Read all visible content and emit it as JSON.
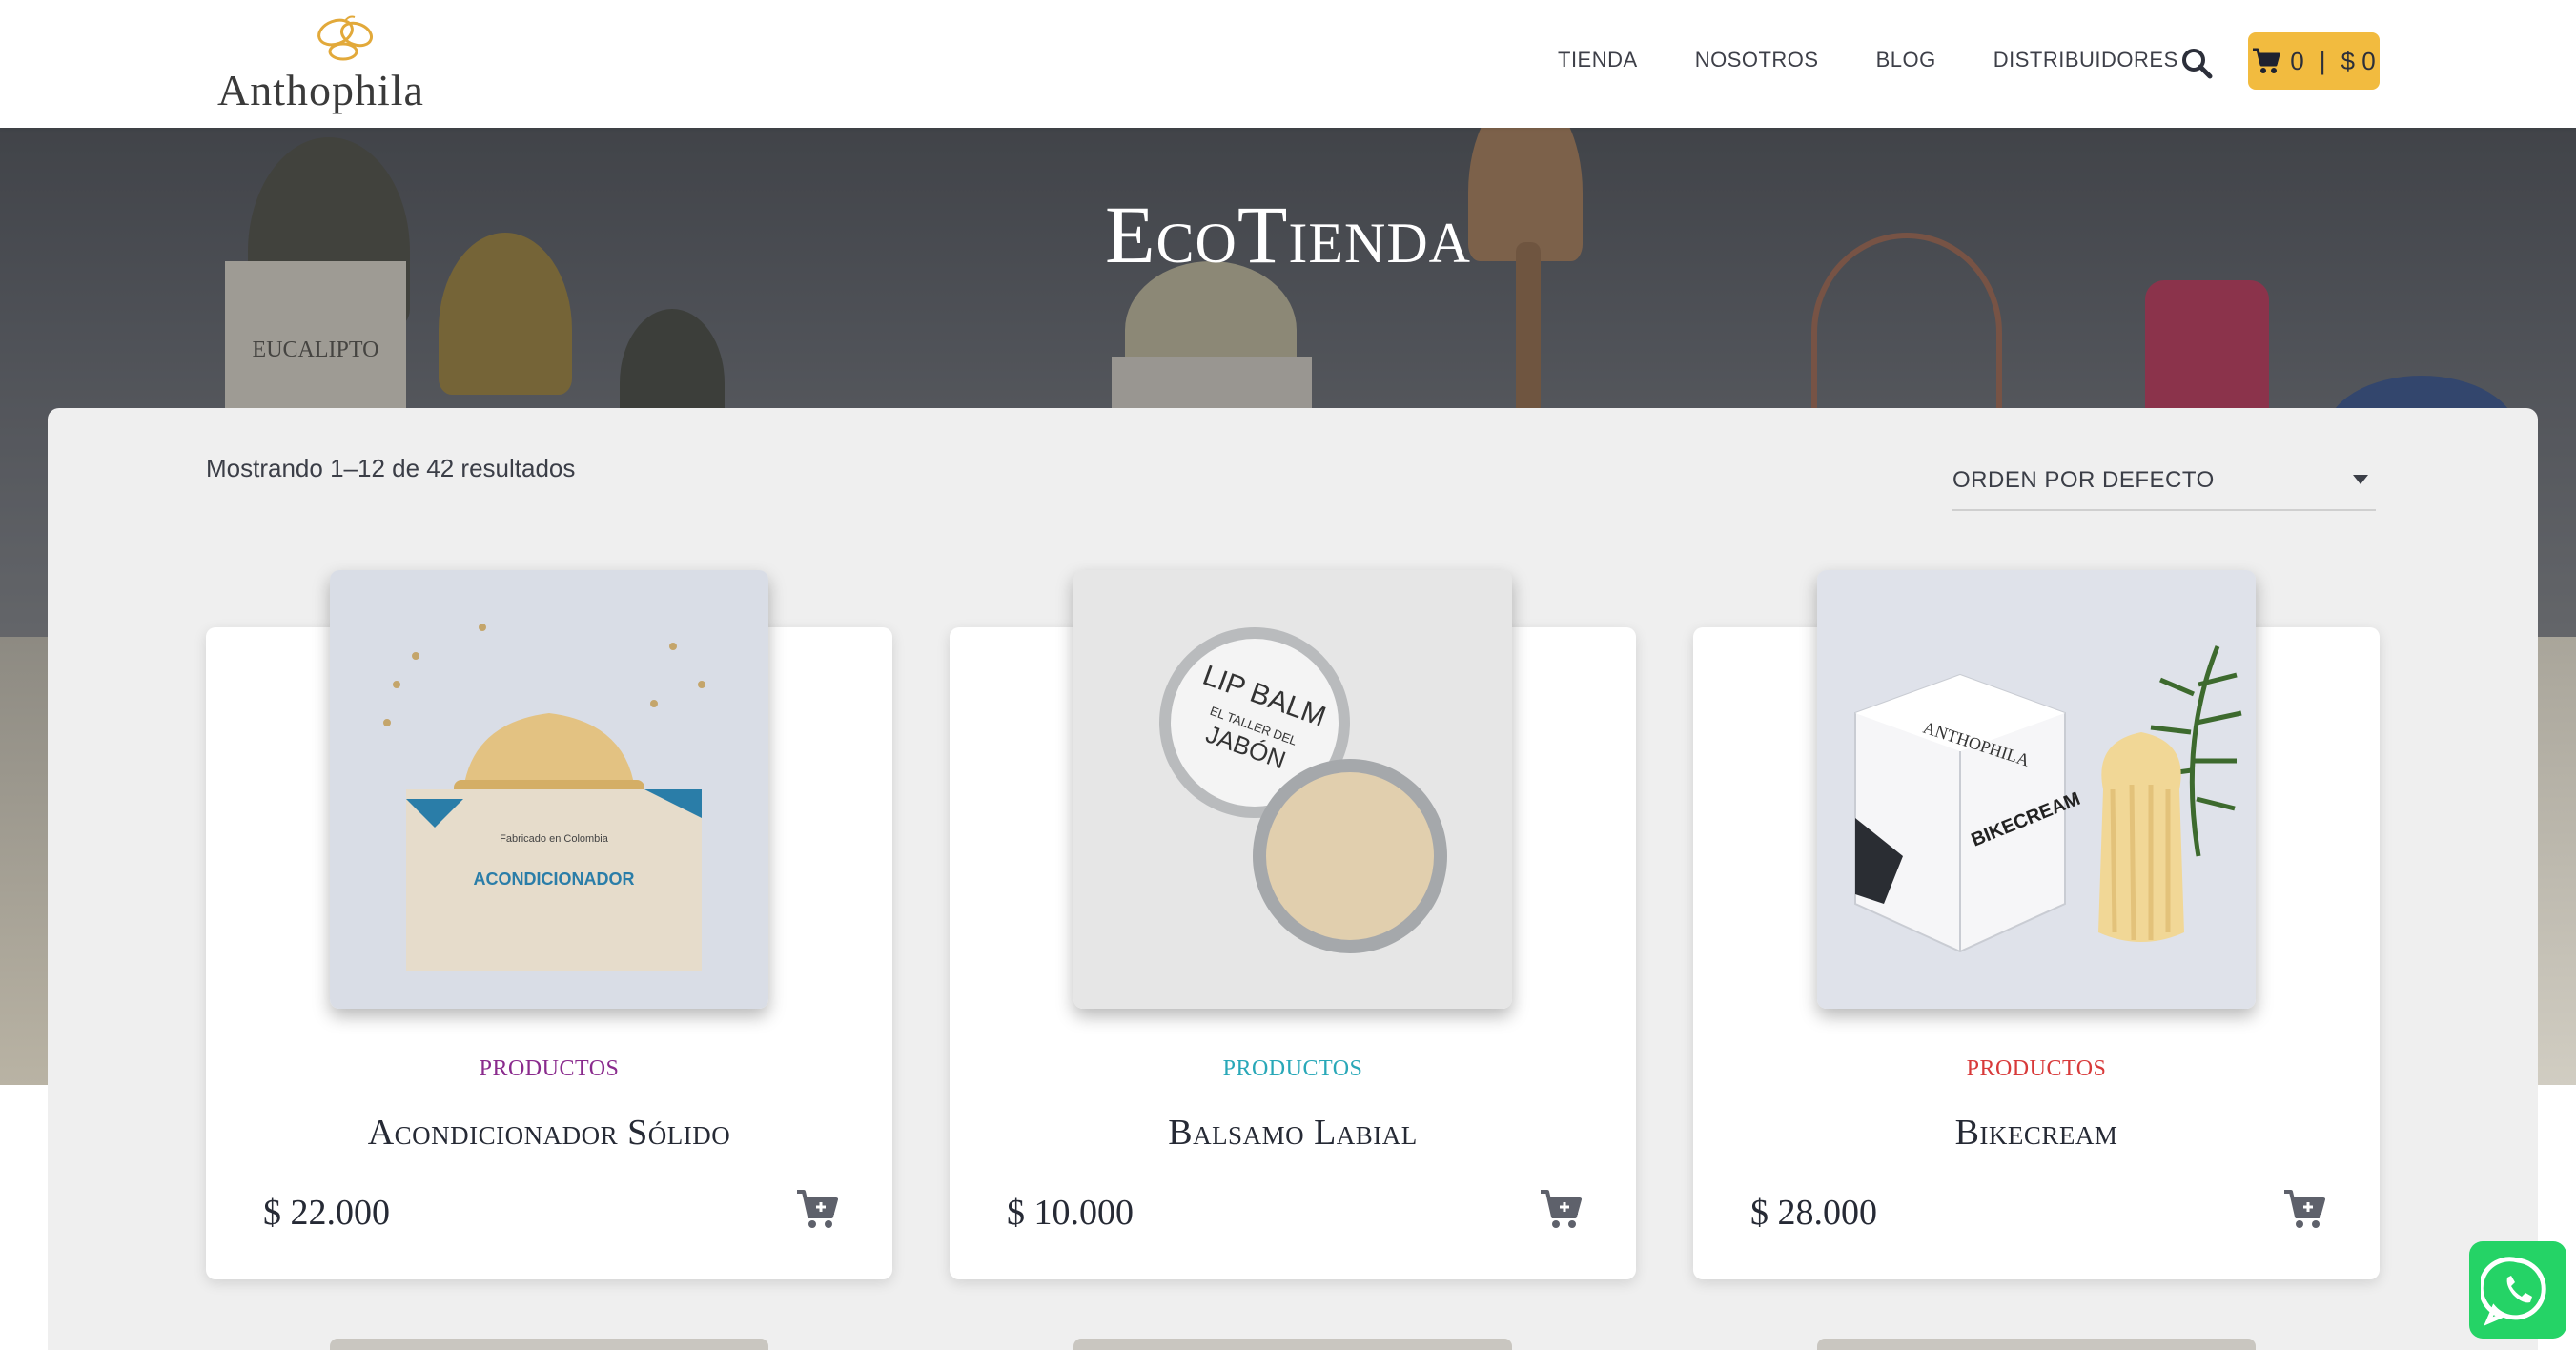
{
  "brand": {
    "name": "Anthophila",
    "accent_color": "#f2bb3f"
  },
  "nav": {
    "items": [
      "TIENDA",
      "NOSOTROS",
      "BLOG",
      "DISTRIBUIDORES"
    ]
  },
  "cart": {
    "count": "0",
    "separator": "|",
    "total": "$ 0"
  },
  "hero": {
    "title": "EcoTienda"
  },
  "results": {
    "text": "Mostrando 1–12 de 42 resultados"
  },
  "sort": {
    "selected": "ORDEN POR DEFECTO"
  },
  "products": [
    {
      "category": "PRODUCTOS",
      "category_color": "#8a2b8d",
      "title": "Acondicionador Sólido",
      "price": "$ 22.000",
      "image_icon": "conditioner-bar-image",
      "box_text": "ACONDICIONADOR",
      "box_small_text": "Fabricado en Colombia"
    },
    {
      "category": "PRODUCTOS",
      "category_color": "#29a8b8",
      "title": "Balsamo Labial",
      "price": "$ 10.000",
      "image_icon": "lip-balm-image",
      "lid_line1": "LIP BALM",
      "lid_line2": "EL TALLER DEL",
      "lid_line3": "JABÓN"
    },
    {
      "category": "PRODUCTOS",
      "category_color": "#d83a3a",
      "title": "Bikecream",
      "price": "$ 28.000",
      "image_icon": "bikecream-image",
      "box_brand": "ANTHOPHILA",
      "box_text": "BIKECREAM"
    }
  ],
  "hero_decor": {
    "box_label": "EUCALIPTO"
  }
}
